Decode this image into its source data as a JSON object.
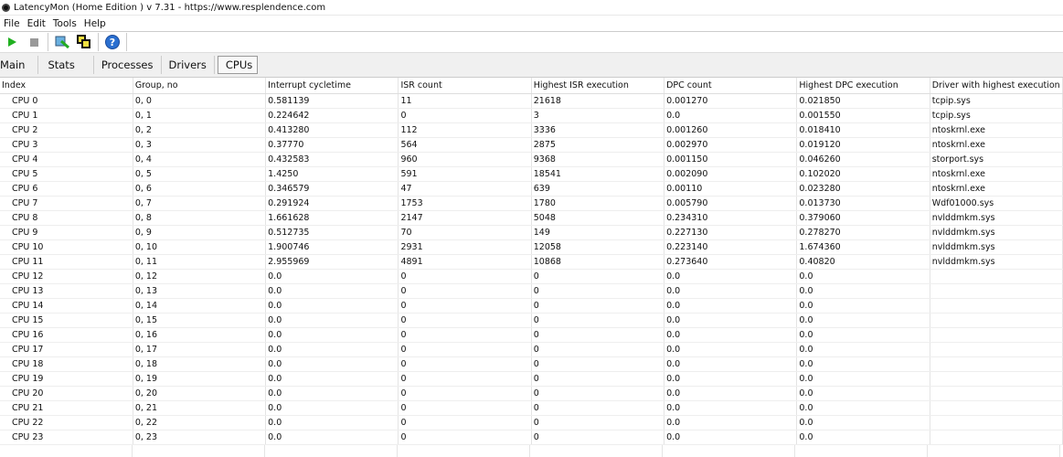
{
  "window": {
    "title": "LatencyMon  (Home Edition )  v 7.31 - https://www.resplendence.com"
  },
  "menu": [
    "File",
    "Edit",
    "Tools",
    "Help"
  ],
  "toolbar": {
    "icons": [
      "play-icon",
      "stop-icon",
      "inspect-icon",
      "copy-icon",
      "help-icon"
    ],
    "help_glyph": "?"
  },
  "tabs": [
    "Main",
    "Stats",
    "Processes",
    "Drivers",
    "CPUs"
  ],
  "active_tab": "CPUs",
  "table": {
    "columns": [
      "Index",
      "Group, no",
      "Interrupt cycletime",
      "ISR count",
      "Highest ISR execution",
      "DPC count",
      "Highest DPC execution",
      "Driver with highest execution"
    ],
    "rows": [
      [
        "CPU 0",
        "0, 0",
        "0.581139",
        "11",
        "21618",
        "0.001270",
        "0.021850",
        "tcpip.sys"
      ],
      [
        "CPU 1",
        "0, 1",
        "0.224642",
        "0",
        "3",
        "0.0",
        "0.001550",
        "tcpip.sys"
      ],
      [
        "CPU 2",
        "0, 2",
        "0.413280",
        "112",
        "3336",
        "0.001260",
        "0.018410",
        "ntoskrnl.exe"
      ],
      [
        "CPU 3",
        "0, 3",
        "0.37770",
        "564",
        "2875",
        "0.002970",
        "0.019120",
        "ntoskrnl.exe"
      ],
      [
        "CPU 4",
        "0, 4",
        "0.432583",
        "960",
        "9368",
        "0.001150",
        "0.046260",
        "storport.sys"
      ],
      [
        "CPU 5",
        "0, 5",
        "1.4250",
        "591",
        "18541",
        "0.002090",
        "0.102020",
        "ntoskrnl.exe"
      ],
      [
        "CPU 6",
        "0, 6",
        "0.346579",
        "47",
        "639",
        "0.00110",
        "0.023280",
        "ntoskrnl.exe"
      ],
      [
        "CPU 7",
        "0, 7",
        "0.291924",
        "1753",
        "1780",
        "0.005790",
        "0.013730",
        "Wdf01000.sys"
      ],
      [
        "CPU 8",
        "0, 8",
        "1.661628",
        "2147",
        "5048",
        "0.234310",
        "0.379060",
        "nvlddmkm.sys"
      ],
      [
        "CPU 9",
        "0, 9",
        "0.512735",
        "70",
        "149",
        "0.227130",
        "0.278270",
        "nvlddmkm.sys"
      ],
      [
        "CPU 10",
        "0, 10",
        "1.900746",
        "2931",
        "12058",
        "0.223140",
        "1.674360",
        "nvlddmkm.sys"
      ],
      [
        "CPU 11",
        "0, 11",
        "2.955969",
        "4891",
        "10868",
        "0.273640",
        "0.40820",
        "nvlddmkm.sys"
      ],
      [
        "CPU 12",
        "0, 12",
        "0.0",
        "0",
        "0",
        "0.0",
        "0.0",
        ""
      ],
      [
        "CPU 13",
        "0, 13",
        "0.0",
        "0",
        "0",
        "0.0",
        "0.0",
        ""
      ],
      [
        "CPU 14",
        "0, 14",
        "0.0",
        "0",
        "0",
        "0.0",
        "0.0",
        ""
      ],
      [
        "CPU 15",
        "0, 15",
        "0.0",
        "0",
        "0",
        "0.0",
        "0.0",
        ""
      ],
      [
        "CPU 16",
        "0, 16",
        "0.0",
        "0",
        "0",
        "0.0",
        "0.0",
        ""
      ],
      [
        "CPU 17",
        "0, 17",
        "0.0",
        "0",
        "0",
        "0.0",
        "0.0",
        ""
      ],
      [
        "CPU 18",
        "0, 18",
        "0.0",
        "0",
        "0",
        "0.0",
        "0.0",
        ""
      ],
      [
        "CPU 19",
        "0, 19",
        "0.0",
        "0",
        "0",
        "0.0",
        "0.0",
        ""
      ],
      [
        "CPU 20",
        "0, 20",
        "0.0",
        "0",
        "0",
        "0.0",
        "0.0",
        ""
      ],
      [
        "CPU 21",
        "0, 21",
        "0.0",
        "0",
        "0",
        "0.0",
        "0.0",
        ""
      ],
      [
        "CPU 22",
        "0, 22",
        "0.0",
        "0",
        "0",
        "0.0",
        "0.0",
        ""
      ],
      [
        "CPU 23",
        "0, 23",
        "0.0",
        "0",
        "0",
        "0.0",
        "0.0",
        ""
      ]
    ]
  }
}
